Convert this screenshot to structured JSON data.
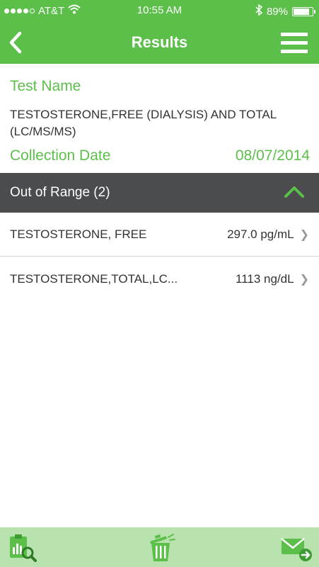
{
  "status_bar": {
    "carrier": "AT&T",
    "time": "10:55 AM",
    "battery": "89%",
    "battery_level": 0.89,
    "signal_bars_filled": 4,
    "signal_bars_total": 5
  },
  "nav": {
    "title": "Results",
    "back_icon": "chevron-left-icon",
    "menu_icon": "hamburger-menu-icon"
  },
  "test": {
    "name_label": "Test Name",
    "name_value": "TESTOSTERONE,FREE (DIALYSIS) AND TOTAL (LC/MS/MS)",
    "collection_label": "Collection Date",
    "collection_date": "08/07/2014"
  },
  "out_of_range": {
    "header": "Out of Range (2)",
    "items": [
      {
        "name": "TESTOSTERONE, FREE",
        "value": "297.0 pg/mL"
      },
      {
        "name": "TESTOSTERONE,TOTAL,LC...",
        "value": "1113 ng/dL"
      }
    ]
  },
  "toolbar": {
    "icons": [
      "clipboard-chart-search-icon",
      "trash-icon",
      "send-mail-icon"
    ]
  },
  "colors": {
    "brand_green": "#5cbf4a",
    "dark_header": "#4a4c4e",
    "toolbar_bg": "#b9e3ae"
  }
}
